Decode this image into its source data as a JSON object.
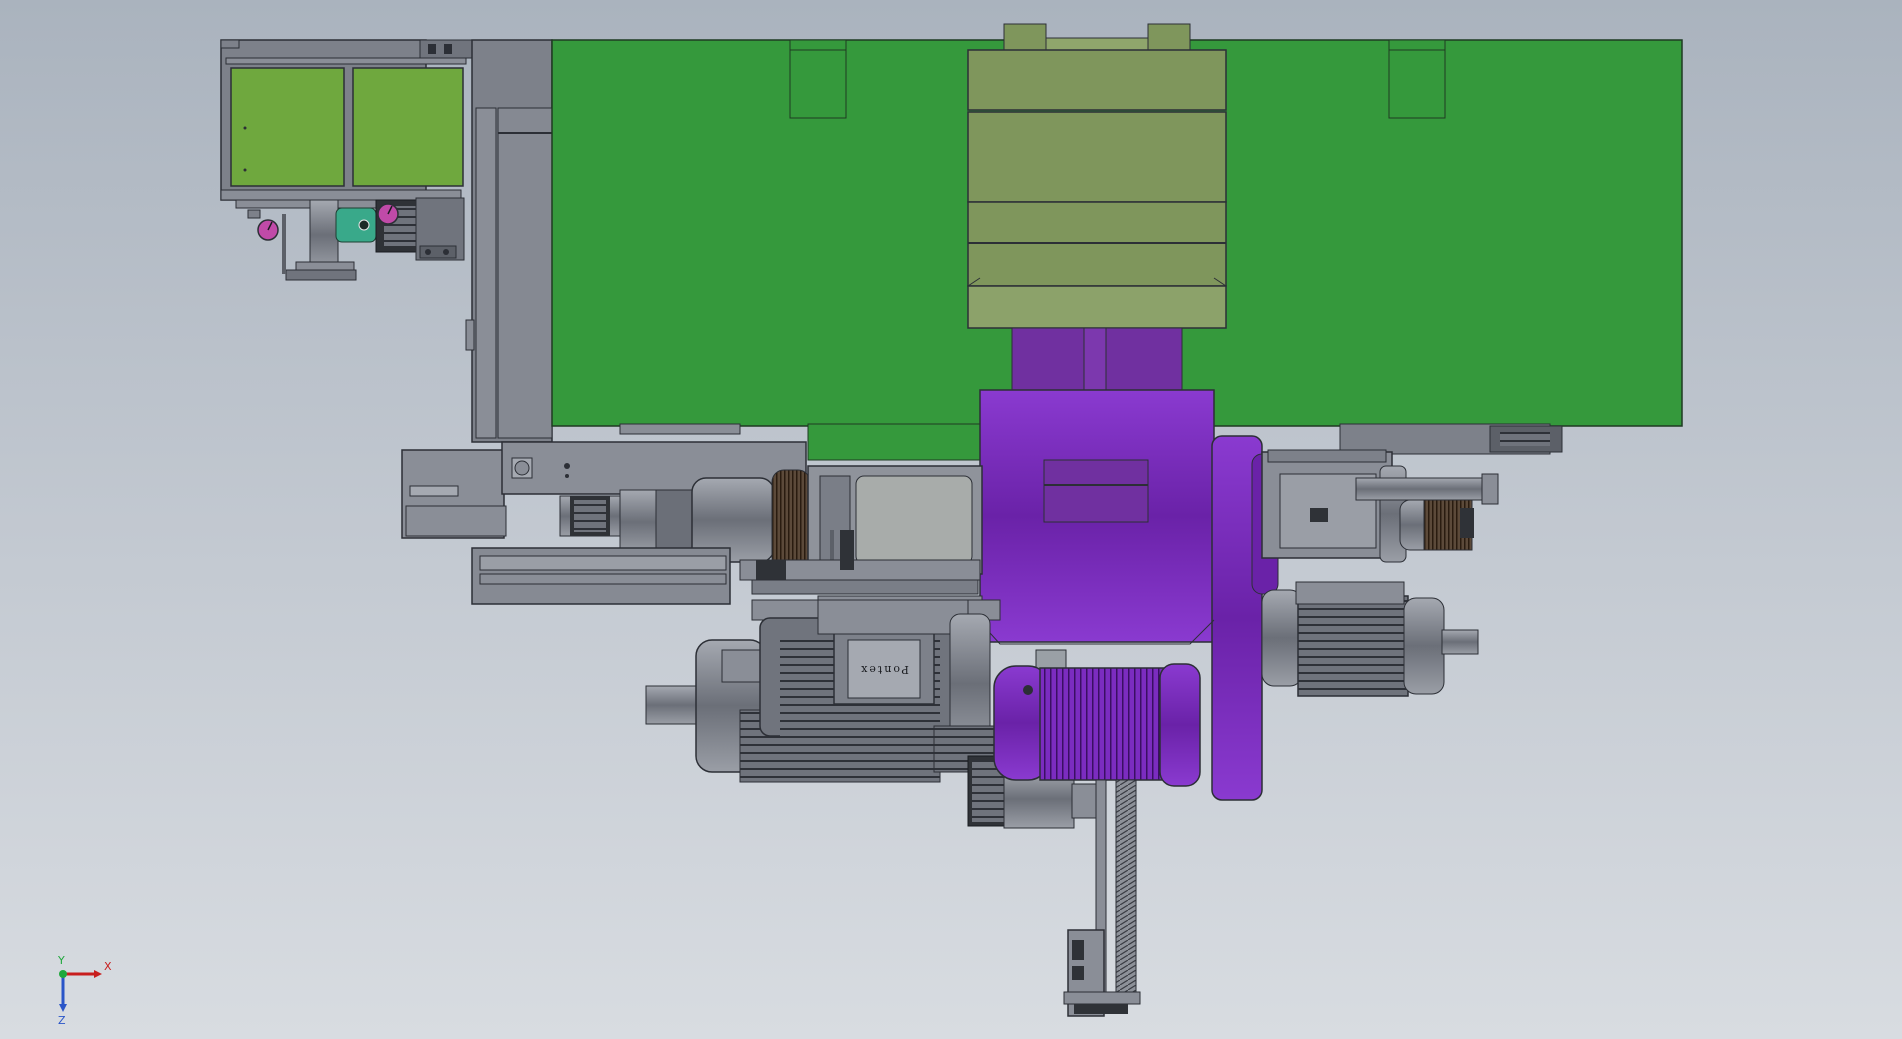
{
  "viewport": {
    "colors": {
      "background_top": "#aab3be",
      "background_bottom": "#d8dce1",
      "frame_gray": "#7d818a",
      "edge": "#2c2f36",
      "green_panel": "#35993c",
      "olive_block": "#7f965c",
      "purple_gearbox": "#7030a0",
      "purple_motor": "#7a2eb8",
      "magenta_gauge": "#c04aa8",
      "teal_fitting": "#39a98a"
    }
  },
  "model": {
    "motor_nameplate_text": "Pontex"
  },
  "triad": {
    "x_label": "X",
    "y_label": "Y",
    "z_label": "Z",
    "x_color": "#c81e1e",
    "y_color": "#1fa83c",
    "z_color": "#2a55c8"
  }
}
